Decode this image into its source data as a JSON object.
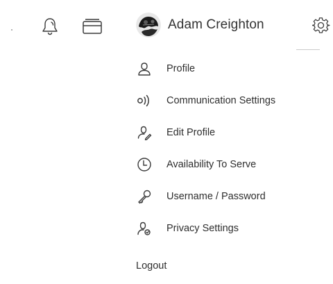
{
  "header": {
    "user_name": "Adam Creighton",
    "icons": {
      "notifications": "bell-icon",
      "cards": "cards-icon",
      "avatar": "avatar-image",
      "settings": "gear-icon"
    }
  },
  "menu": {
    "items": [
      {
        "label": "Profile",
        "icon": "person-icon"
      },
      {
        "label": "Communication Settings",
        "icon": "broadcast-icon"
      },
      {
        "label": "Edit Profile",
        "icon": "edit-profile-icon"
      },
      {
        "label": "Availability To Serve",
        "icon": "clock-icon"
      },
      {
        "label": "Username / Password",
        "icon": "key-icon"
      },
      {
        "label": "Privacy Settings",
        "icon": "privacy-icon"
      }
    ],
    "logout_label": "Logout"
  },
  "colors": {
    "text": "#2e2e2e",
    "icon_stroke": "#3a3a3a",
    "background": "#ffffff"
  }
}
